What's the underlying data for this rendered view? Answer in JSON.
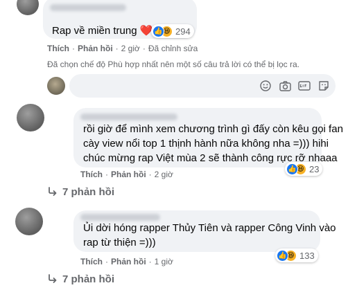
{
  "comments": [
    {
      "text": "Rap về miền trung ❤️",
      "reaction_count": "294",
      "like_label": "Thích",
      "reply_label": "Phản hồi",
      "time": "2 giờ",
      "edited": "Đã chỉnh sửa"
    },
    {
      "line1": "rồi giờ để mình xem chương trình gì đấy còn kêu gọi fan",
      "line2": "cày view nổi top 1 thịnh hành nữa không nha =))) hihi",
      "line3": "chúc mừng rap Việt mùa 2 sẽ thành công rực rỡ nhaaa",
      "reaction_count": "23",
      "like_label": "Thích",
      "reply_label": "Phản hồi",
      "time": "2 giờ",
      "replies_label": "7 phản hồi"
    },
    {
      "line1": "Ủi dời hóng rapper Thủy Tiên và rapper Công Vinh vào",
      "line2": "rap từ thiện =)))",
      "reaction_count": "133",
      "like_label": "Thích",
      "reply_label": "Phản hồi",
      "time": "1 giờ",
      "replies_label": "7 phản hồi"
    }
  ],
  "filter_note": "Đã chọn chế độ Phù hợp nhất nên một số câu trả lời có thể bị lọc ra.",
  "icons": [
    "like-icon",
    "haha-icon",
    "smiley-icon",
    "camera-icon",
    "gif-icon",
    "sticker-icon",
    "reply-arrow-icon"
  ],
  "colors": {
    "bubble": "#f0f2f5",
    "secondary_text": "#65676b",
    "like_blue": "#1877f2",
    "heart_red": "#f33e58",
    "haha_yellow": "#f7b125"
  }
}
